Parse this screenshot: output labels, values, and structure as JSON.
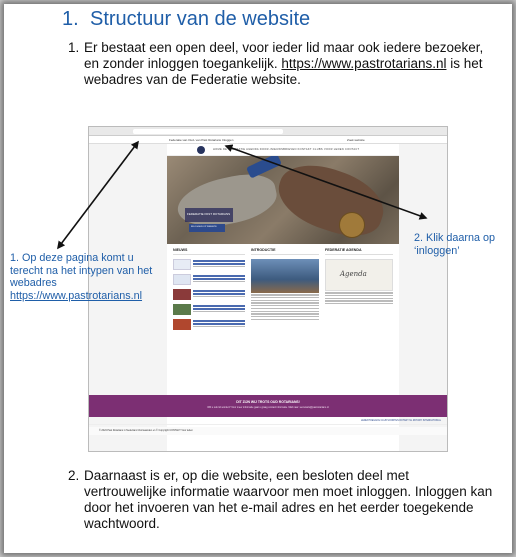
{
  "heading": {
    "number": "1.",
    "title": "Structuur van de website"
  },
  "paragraph1": {
    "number": "1.",
    "text_before": "Er bestaat een open deel, voor ieder lid maar ook iedere bezoeker, en zonder inloggen toegankelijk. ",
    "link": "https://www.pastrotarians.nl",
    "text_after": " is het webadres van de Federatie website."
  },
  "left_note": {
    "text": "1. Op deze pagina komt u terecht na het intypen van het webadres ",
    "link": "https://www.pastrotarians.nl"
  },
  "right_note": {
    "text": "2. Klik daarna op ‘inloggen’"
  },
  "screenshot": {
    "topbar_left": "Federatie van Oud- van Past Rotarians    Inloggen",
    "topbar_right": "Zoek website",
    "nav": "HOME   DE FEDERATIE   AGENDA   DOOR-/NIEUWSBRIEVEN   KONTAKT   CLUBS   VOOR LEDEN   CONTACT",
    "hero_band": "FEDERATIE PAST ROTARIANS",
    "hero_button": "INLOGGEN OP WEBSITE",
    "col_news": "NIEUWS",
    "col_intro": "INTRODUCTIE",
    "col_agenda": "FEDERATIE AGENDA",
    "agenda_word": "Agenda",
    "banner_title": "DIT ZIJN WIJ TROTS OUD ROTARIANS!",
    "banner_sub": "Wilt u ook lid worden? Voor meer informatie gaat u graag contact informatie. Mail naar: secretaris@pastrotarians.nl",
    "footer_nav": "LEDENTOEGANG   CLUB SOORTEN   ROTARY NL   ROTARY INTERNATIONAL",
    "copyright": "© 2024 Past Rotarians in Nederland    Voorwaarden en © Copyright   CONTACT   Voor leden"
  },
  "paragraph2": {
    "number": "2.",
    "text": "Daarnaast is er, op die website, een besloten deel met vertrouwelijke informatie waarvoor men moet inloggen. Inloggen kan door het invoeren van het e-mail adres en het eerder toegekende wachtwoord."
  }
}
